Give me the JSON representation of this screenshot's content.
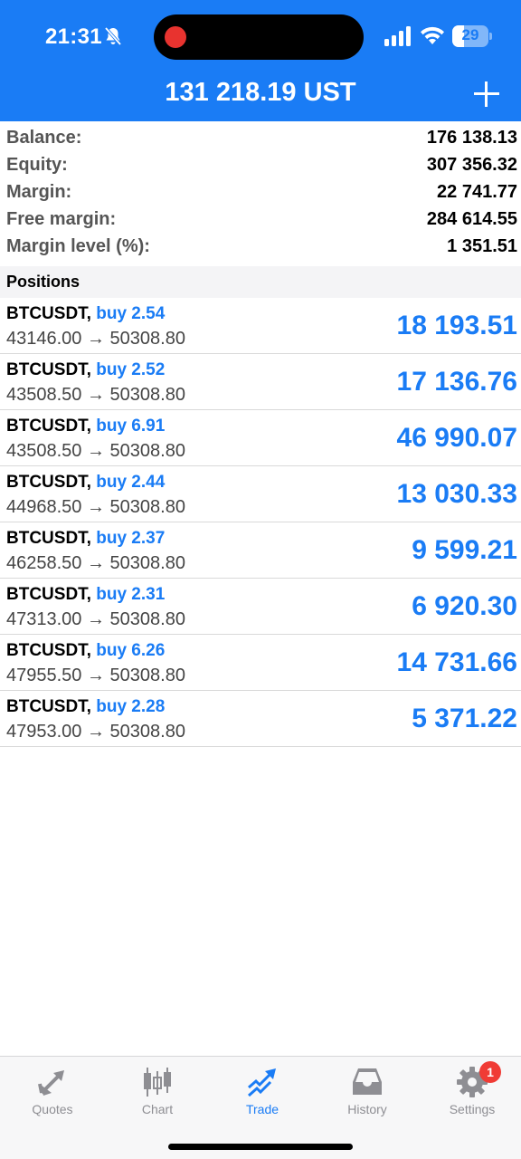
{
  "status_bar": {
    "time": "21:31",
    "battery_level": "29"
  },
  "header": {
    "title": "131 218.19 UST"
  },
  "account": [
    {
      "label": "Balance:",
      "value": "176 138.13"
    },
    {
      "label": "Equity:",
      "value": "307 356.32"
    },
    {
      "label": "Margin:",
      "value": "22 741.77"
    },
    {
      "label": "Free margin:",
      "value": "284 614.55"
    },
    {
      "label": "Margin level (%):",
      "value": "1 351.51"
    }
  ],
  "positions_title": "Positions",
  "positions": [
    {
      "symbol": "BTCUSDT,",
      "type": "buy 2.54",
      "prices": "43146.00 → 50308.80",
      "profit": "18 193.51"
    },
    {
      "symbol": "BTCUSDT,",
      "type": "buy 2.52",
      "prices": "43508.50 → 50308.80",
      "profit": "17 136.76"
    },
    {
      "symbol": "BTCUSDT,",
      "type": "buy 6.91",
      "prices": "43508.50 → 50308.80",
      "profit": "46 990.07"
    },
    {
      "symbol": "BTCUSDT,",
      "type": "buy 2.44",
      "prices": "44968.50 → 50308.80",
      "profit": "13 030.33"
    },
    {
      "symbol": "BTCUSDT,",
      "type": "buy 2.37",
      "prices": "46258.50 → 50308.80",
      "profit": "9 599.21"
    },
    {
      "symbol": "BTCUSDT,",
      "type": "buy 2.31",
      "prices": "47313.00 → 50308.80",
      "profit": "6 920.30"
    },
    {
      "symbol": "BTCUSDT,",
      "type": "buy 6.26",
      "prices": "47955.50 → 50308.80",
      "profit": "14 731.66"
    },
    {
      "symbol": "BTCUSDT,",
      "type": "buy 2.28",
      "prices": "47953.00 → 50308.80",
      "profit": "5 371.22"
    }
  ],
  "tabs": [
    {
      "label": "Quotes",
      "icon": "quotes-arrows-icon"
    },
    {
      "label": "Chart",
      "icon": "candlestick-icon"
    },
    {
      "label": "Trade",
      "icon": "trade-trend-icon",
      "active": true
    },
    {
      "label": "History",
      "icon": "inbox-tray-icon"
    },
    {
      "label": "Settings",
      "icon": "gear-icon",
      "badge": "1"
    }
  ],
  "colors": {
    "accent": "#1a7cf5",
    "badge": "#f03b35",
    "recording": "#e8332f"
  }
}
